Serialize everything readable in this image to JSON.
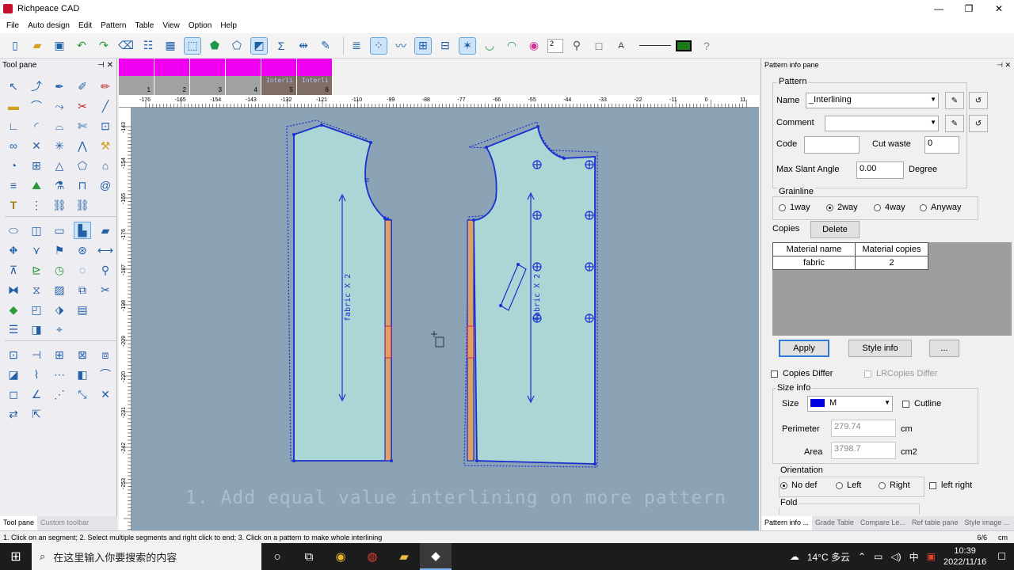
{
  "window": {
    "title": "Richpeace CAD",
    "controls": {
      "minimize": "—",
      "maximize": "❐",
      "close": "✕"
    }
  },
  "menu": [
    "File",
    "Auto design",
    "Edit",
    "Pattern",
    "Table",
    "View",
    "Option",
    "Help"
  ],
  "toolbar": {
    "number_value": "2",
    "letter": "A"
  },
  "tool_pane": {
    "title": "Tool pane",
    "pin": "⊣",
    "close": "✕",
    "tabs": [
      "Tool pane",
      "Custom toolbar"
    ]
  },
  "pieces": [
    {
      "num": "1",
      "label": ""
    },
    {
      "num": "2",
      "label": ""
    },
    {
      "num": "3",
      "label": ""
    },
    {
      "num": "4",
      "label": ""
    },
    {
      "num": "5",
      "label": "Interli"
    },
    {
      "num": "6",
      "label": "Interli"
    }
  ],
  "ruler": {
    "top_ticks": [
      "-176",
      "-165",
      "-154",
      "-143",
      "-132",
      "-121",
      "-110",
      "-99",
      "-88",
      "-77",
      "-66",
      "-55",
      "-44",
      "-33",
      "-22",
      "-11",
      "0",
      "11"
    ],
    "left_ticks": [
      "-143",
      "-154",
      "-165",
      "-176",
      "-187",
      "-198",
      "-209",
      "-220",
      "-231",
      "-242",
      "-253"
    ]
  },
  "canvas": {
    "piece_text_left": "fabric X 2",
    "piece_text_right": "fabric X 2",
    "caption": "1. Add equal value interlining on more pattern"
  },
  "info_pane": {
    "title": "Pattern info pane",
    "pattern_legend": "Pattern",
    "name_label": "Name",
    "name_value": "_Interlining",
    "comment_label": "Comment",
    "comment_value": "",
    "code_label": "Code",
    "code_value": "",
    "cut_waste_label": "Cut waste",
    "cut_waste_value": "0",
    "max_slant_label": "Max Slant Angle",
    "max_slant_value": "0.00",
    "degree_label": "Degree",
    "grainline_legend": "Grainline",
    "grainline_options": [
      "1way",
      "2way",
      "4way",
      "Anyway"
    ],
    "grainline_selected": "2way",
    "copies_label": "Copies",
    "delete_button": "Delete",
    "table_headers": [
      "Material name",
      "Material copies"
    ],
    "table_rows": [
      [
        "fabric",
        "2"
      ]
    ],
    "apply_button": "Apply",
    "style_info_button": "Style info",
    "more_button": "...",
    "copies_differ": "Copies Differ",
    "lr_copies_differ": "LRCopies Differ",
    "size_info_legend": "Size info",
    "size_label": "Size",
    "size_value": "M",
    "size_color": "#0000e0",
    "cutline_label": "Cutline",
    "perimeter_label": "Perimeter",
    "perimeter_value": "279.74",
    "perimeter_unit": "cm",
    "area_label": "Area",
    "area_value": "3798.7",
    "area_unit": "cm2",
    "orientation_legend": "Orientation",
    "orientation_options": [
      "No def",
      "Left",
      "Right"
    ],
    "orientation_selected": "No def",
    "left_right_label": "left right",
    "fold_legend": "Fold",
    "tabs": [
      "Pattern info ...",
      "Grade Table",
      "Compare Le...",
      "Ref table pane",
      "Style image ..."
    ]
  },
  "status": {
    "hint": "1. Click on an segment; 2. Select multiple segments and right click to end; 3. Click on a pattern to make whole interlining",
    "count": "6/6",
    "unit": "cm"
  },
  "taskbar": {
    "search_placeholder": "在这里输入你要搜索的内容",
    "weather": "14°C 多云",
    "time": "10:39",
    "date": "2022/11/16",
    "ime": "中"
  },
  "colors": {
    "canvas_bg": "#8ba3b5",
    "piece_fill": "#aad6d6",
    "outline": "#1a2fd0",
    "interlining": "#e0a060",
    "thumb_magenta": "#f000f0"
  }
}
